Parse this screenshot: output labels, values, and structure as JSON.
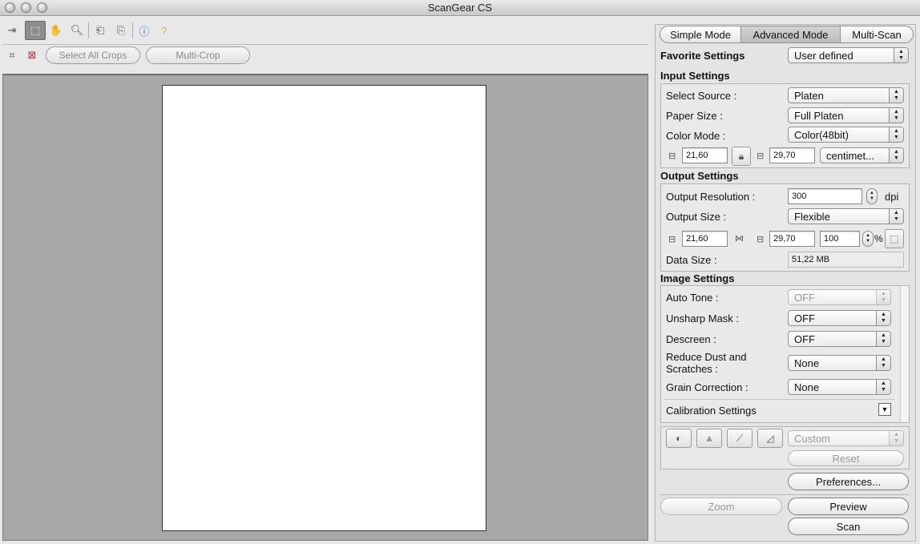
{
  "window": {
    "title": "ScanGear CS"
  },
  "toolbar": {
    "select_all_crops": "Select All Crops",
    "multi_crop": "Multi-Crop"
  },
  "tabs": [
    "Simple Mode",
    "Advanced Mode",
    "Multi-Scan"
  ],
  "favorite": {
    "label": "Favorite Settings",
    "value": "User defined"
  },
  "input_settings": {
    "title": "Input Settings",
    "select_source_label": "Select Source :",
    "select_source_value": "Platen",
    "paper_size_label": "Paper Size :",
    "paper_size_value": "Full Platen",
    "color_mode_label": "Color Mode :",
    "color_mode_value": "Color(48bit)",
    "width": "21,60",
    "height": "29,70",
    "unit": "centimet..."
  },
  "output_settings": {
    "title": "Output Settings",
    "resolution_label": "Output Resolution :",
    "resolution_value": "300",
    "resolution_unit": "dpi",
    "size_label": "Output Size :",
    "size_value": "Flexible",
    "width": "21,60",
    "height": "29,70",
    "scale": "100",
    "scale_unit": "%",
    "data_size_label": "Data Size :",
    "data_size_value": "51,22 MB"
  },
  "image_settings": {
    "title": "Image Settings",
    "auto_tone_label": "Auto Tone :",
    "auto_tone_value": "OFF",
    "unsharp_label": "Unsharp Mask :",
    "unsharp_value": "OFF",
    "descreen_label": "Descreen :",
    "descreen_value": "OFF",
    "dust_label": "Reduce Dust and Scratches :",
    "dust_value": "None",
    "grain_label": "Grain Correction :",
    "grain_value": "None",
    "calibration_label": "Calibration Settings"
  },
  "adjust": {
    "preset": "Custom",
    "reset": "Reset"
  },
  "buttons": {
    "preferences": "Preferences...",
    "zoom": "Zoom",
    "preview": "Preview",
    "scan": "Scan"
  }
}
